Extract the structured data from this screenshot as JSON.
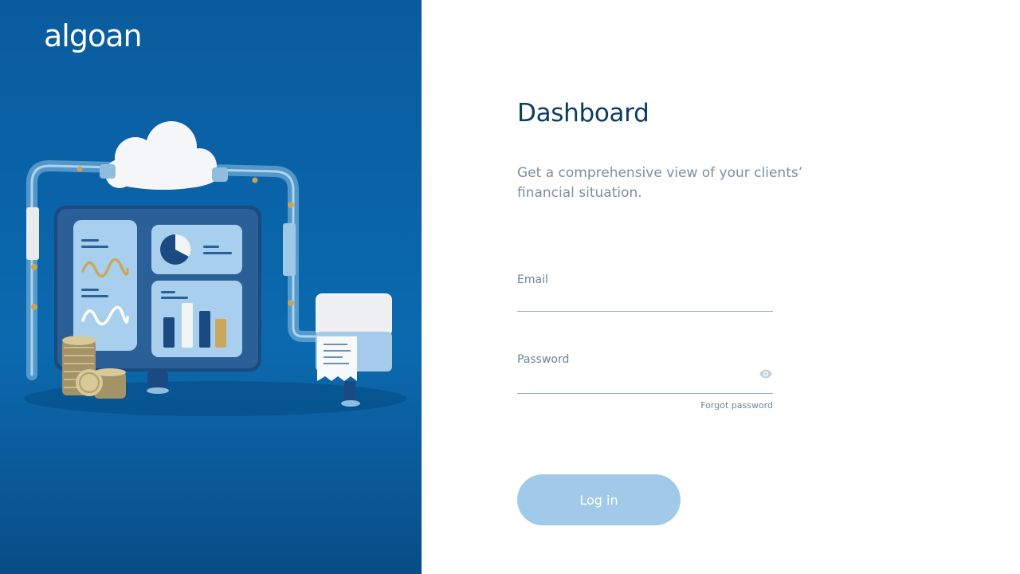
{
  "brand": {
    "logo_text": "algoan"
  },
  "main": {
    "title": "Dashboard",
    "subtitle": "Get a comprehensive view of your clients’ financial situation."
  },
  "form": {
    "email_label": "Email",
    "email_value": "",
    "password_label": "Password",
    "password_value": "",
    "forgot_password_label": "Forgot password",
    "login_label": "Log in"
  },
  "icons": {
    "password_toggle": "eye-icon"
  },
  "colors": {
    "left_panel": "#0a63a8",
    "title": "#0b3d61",
    "muted_text": "#7b8fa1",
    "button": "#a1cae9"
  }
}
